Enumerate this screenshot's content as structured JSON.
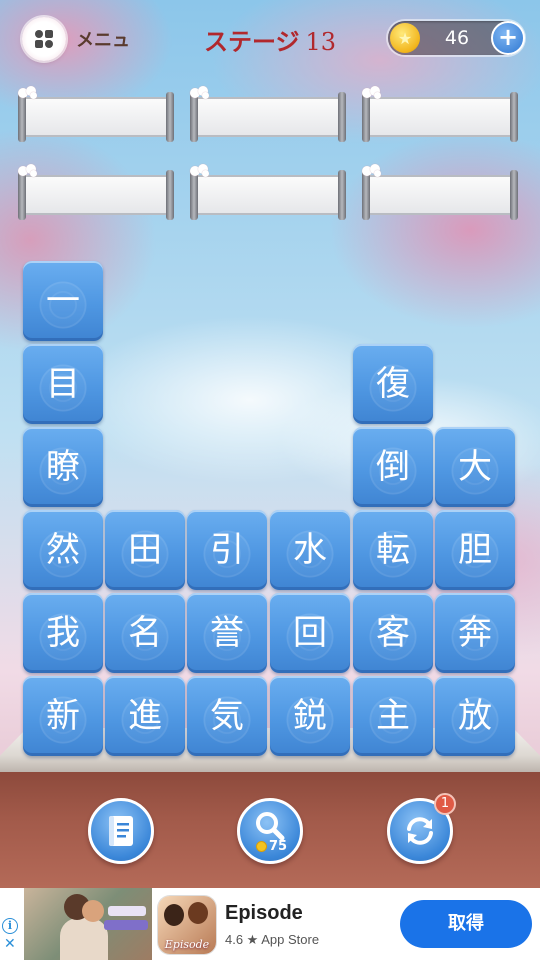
{
  "header": {
    "menu_label": "メニュ",
    "stage_label": "ステージ",
    "stage_number": "13",
    "coins": "46",
    "add_coins_label": "+"
  },
  "answer_slots": [
    "",
    "",
    "",
    "",
    "",
    ""
  ],
  "board": {
    "tiles": [
      {
        "char": "一",
        "col": 0,
        "row": 5
      },
      {
        "char": "目",
        "col": 0,
        "row": 4
      },
      {
        "char": "瞭",
        "col": 0,
        "row": 3
      },
      {
        "char": "然",
        "col": 0,
        "row": 2
      },
      {
        "char": "我",
        "col": 0,
        "row": 1
      },
      {
        "char": "新",
        "col": 0,
        "row": 0
      },
      {
        "char": "田",
        "col": 1,
        "row": 2
      },
      {
        "char": "名",
        "col": 1,
        "row": 1
      },
      {
        "char": "進",
        "col": 1,
        "row": 0
      },
      {
        "char": "引",
        "col": 2,
        "row": 2
      },
      {
        "char": "誉",
        "col": 2,
        "row": 1
      },
      {
        "char": "気",
        "col": 2,
        "row": 0
      },
      {
        "char": "水",
        "col": 3,
        "row": 2
      },
      {
        "char": "回",
        "col": 3,
        "row": 1
      },
      {
        "char": "鋭",
        "col": 3,
        "row": 0
      },
      {
        "char": "復",
        "col": 4,
        "row": 4
      },
      {
        "char": "倒",
        "col": 4,
        "row": 3
      },
      {
        "char": "転",
        "col": 4,
        "row": 2
      },
      {
        "char": "客",
        "col": 4,
        "row": 1
      },
      {
        "char": "主",
        "col": 4,
        "row": 0
      },
      {
        "char": "大",
        "col": 5,
        "row": 3
      },
      {
        "char": "胆",
        "col": 5,
        "row": 2
      },
      {
        "char": "奔",
        "col": 5,
        "row": 1
      },
      {
        "char": "放",
        "col": 5,
        "row": 0
      }
    ]
  },
  "toolbar": {
    "hint_cost": "75",
    "shuffle_badge": "1",
    "icons": [
      "book-icon",
      "magnifier-icon",
      "refresh-icon"
    ]
  },
  "ad": {
    "title": "Episode",
    "subtitle": "4.6 ★ App Store",
    "cta": "取得",
    "icon_label": "Episode",
    "info_glyph": "i",
    "close_glyph": "✕"
  },
  "colors": {
    "tile": "#4f97e2",
    "stage_text": "#b1282d",
    "cta": "#1a73e8"
  }
}
